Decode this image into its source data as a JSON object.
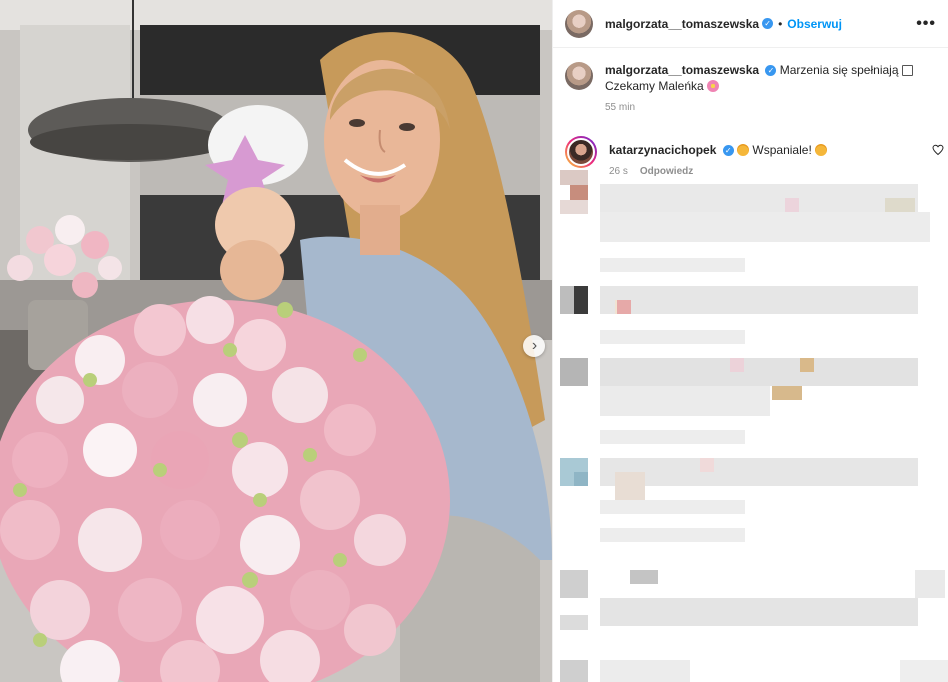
{
  "post": {
    "author": "malgorzata__tomaszewska",
    "follow_label": "Obserwuj",
    "dot": "•",
    "more_label": "•••",
    "verified_mark": "✓",
    "carousel_next": "›"
  },
  "caption": {
    "author": "malgorzata__tomaszewska",
    "text": "Marzenia się spełniają",
    "text2": "Czekamy Maleńka",
    "time": "55 min"
  },
  "comments": [
    {
      "author": "katarzynacichopek",
      "text": "Wspaniale!",
      "time": "26 s",
      "reply_label": "Odpowiedz"
    }
  ],
  "colors": {
    "accent": "#0095f6",
    "verified": "#3897f0",
    "text": "#262626",
    "muted": "#8e8e8e"
  },
  "icons": [
    "verified-icon",
    "more-icon",
    "heart-icon",
    "chevron-right-icon"
  ]
}
